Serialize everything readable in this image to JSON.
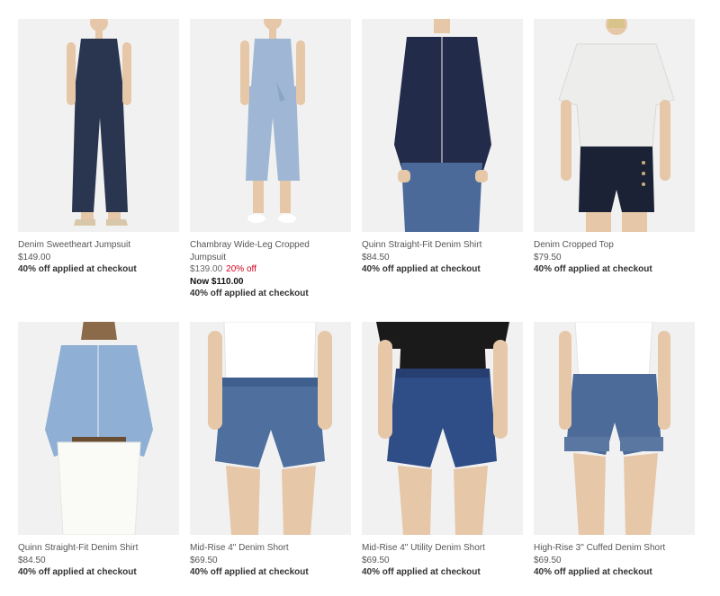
{
  "products": [
    {
      "name": "Denim Sweetheart Jumpsuit",
      "price": "$149.00",
      "promo": "40% off applied at checkout"
    },
    {
      "name_line1": "Chambray Wide-Leg Cropped",
      "name_line2": "Jumpsuit",
      "was_price": "$139.00",
      "percent_off": "20% off",
      "now_price": "Now $110.00",
      "promo": "40% off applied at checkout"
    },
    {
      "name": "Quinn Straight-Fit Denim Shirt",
      "price": "$84.50",
      "promo": "40% off applied at checkout"
    },
    {
      "name": "Denim Cropped Top",
      "price": "$79.50",
      "promo": "40% off applied at checkout"
    },
    {
      "name": "Quinn Straight-Fit Denim Shirt",
      "price": "$84.50",
      "promo": "40% off applied at checkout"
    },
    {
      "name": "Mid-Rise 4\" Denim Short",
      "price": "$69.50",
      "promo": "40% off applied at checkout"
    },
    {
      "name": "Mid-Rise 4\" Utility Denim Short",
      "price": "$69.50",
      "promo": "40% off applied at checkout"
    },
    {
      "name": "High-Rise 3\" Cuffed Denim Short",
      "price": "$69.50",
      "promo": "40% off applied at checkout"
    }
  ],
  "colors": {
    "sale_red": "#d0021b",
    "image_background": "#f1f1f1",
    "dark_denim": "#2a3550",
    "light_chambray": "#9fb7d4",
    "mid_denim": "#3f5f8f"
  }
}
